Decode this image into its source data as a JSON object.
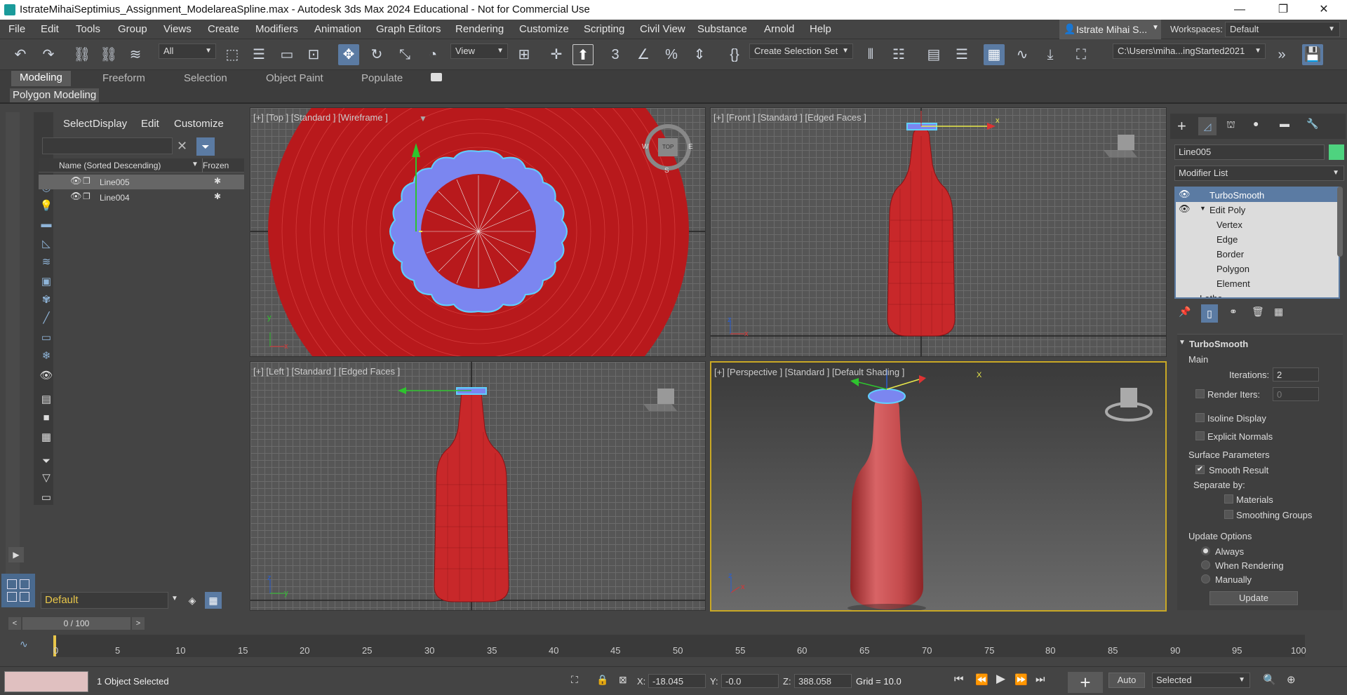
{
  "window": {
    "title": "IstrateMihaiSeptimius_Assignment_ModelareaSpline.max - Autodesk 3ds Max 2024 Educational - Not for Commercial Use",
    "minimize": "—",
    "maximize": "❐",
    "close": "✕"
  },
  "menu": [
    "File",
    "Edit",
    "Tools",
    "Group",
    "Views",
    "Create",
    "Modifiers",
    "Animation",
    "Graph Editors",
    "Rendering",
    "Customize",
    "Scripting",
    "Civil View",
    "Substance",
    "Arnold",
    "Help"
  ],
  "user": {
    "name": "Istrate Mihai S...",
    "workspaces_label": "Workspaces:",
    "workspace": "Default"
  },
  "toolbar": {
    "filter": "All",
    "view": "View",
    "selection_set": "Create Selection Set",
    "path": "C:\\Users\\miha...ingStarted2021"
  },
  "ribbon": {
    "tabs": [
      "Modeling",
      "Freeform",
      "Selection",
      "Object Paint",
      "Populate"
    ],
    "active": "Modeling",
    "subrow": "Polygon Modeling"
  },
  "explorer": {
    "tabs": [
      "Select",
      "Display",
      "Edit",
      "Customize"
    ],
    "col_name": "Name (Sorted Descending)",
    "col_frozen": "Frozen",
    "rows": [
      "Line005",
      "Line004"
    ],
    "layer": "Default"
  },
  "viewports": {
    "top": "[+] [Top ] [Standard ] [Wireframe ]",
    "front": "[+] [Front ] [Standard ] [Edged Faces ]",
    "left": "[+] [Left ] [Standard ] [Edged Faces ]",
    "persp": "[+] [Perspective ] [Standard ] [Default Shading ]",
    "cube_top": "TOP",
    "compass": [
      "W",
      "E",
      "S"
    ],
    "axis_x": "x",
    "axis_y": "y",
    "axis_z": "z",
    "axis_X": "X"
  },
  "command_panel": {
    "object_name": "Line005",
    "modifier_list": "Modifier List",
    "stack": [
      "TurboSmooth",
      "Edit Poly",
      "Vertex",
      "Edge",
      "Border",
      "Polygon",
      "Element",
      "Lathe"
    ],
    "rollout_title": "TurboSmooth",
    "main": "Main",
    "iterations_label": "Iterations:",
    "iterations": "2",
    "render_iters_label": "Render Iters:",
    "render_iters": "0",
    "isoline": "Isoline Display",
    "explicit": "Explicit Normals",
    "surface_params": "Surface Parameters",
    "smooth_result": "Smooth Result",
    "separate_by": "Separate by:",
    "materials": "Materials",
    "smoothing_groups": "Smoothing Groups",
    "update_options": "Update Options",
    "always": "Always",
    "when_rendering": "When Rendering",
    "manually": "Manually",
    "update": "Update"
  },
  "timeline": {
    "frame": "0 / 100",
    "ticks": [
      "0",
      "5",
      "10",
      "15",
      "20",
      "25",
      "30",
      "35",
      "40",
      "45",
      "50",
      "55",
      "60",
      "65",
      "70",
      "75",
      "80",
      "85",
      "90",
      "95",
      "100"
    ]
  },
  "status": {
    "selected": "1 Object Selected",
    "x_label": "X:",
    "x": "-18.045",
    "y_label": "Y:",
    "y": "-0.0",
    "z_label": "Z:",
    "z": "388.058",
    "grid": "Grid = 10.0",
    "auto": "Auto",
    "selected_dd": "Selected"
  },
  "colors": {
    "accent": "#5b7ba3",
    "bottle": "#c8282a",
    "cap": "#7b86f0",
    "selection_cyan": "#5fd0ff"
  }
}
